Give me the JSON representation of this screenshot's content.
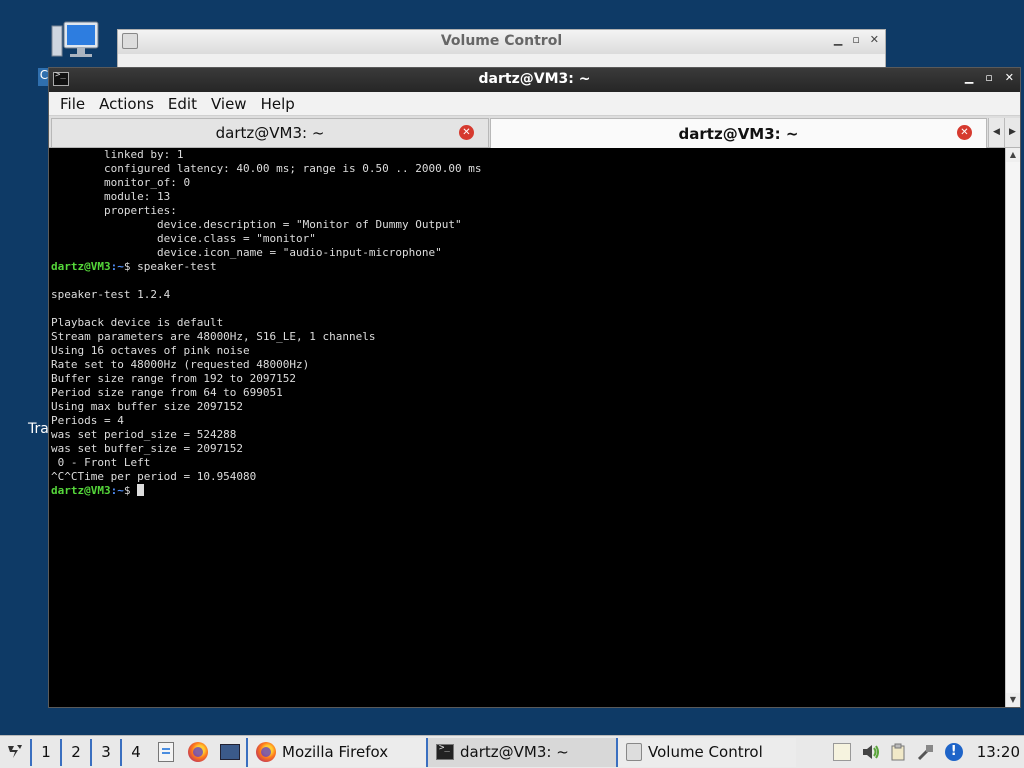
{
  "desktop": {
    "partial_label_left": "Tra",
    "partial_label_c": "C"
  },
  "volume_window": {
    "title": "Volume Control"
  },
  "terminal_window": {
    "title": "dartz@VM3: ~",
    "menu": [
      "File",
      "Actions",
      "Edit",
      "View",
      "Help"
    ],
    "tabs": [
      {
        "label": "dartz@VM3: ~",
        "active": false
      },
      {
        "label": "dartz@VM3: ~",
        "active": true
      }
    ],
    "lines": [
      {
        "text": "        linked by: 1"
      },
      {
        "text": "        configured latency: 40.00 ms; range is 0.50 .. 2000.00 ms"
      },
      {
        "text": "        monitor_of: 0"
      },
      {
        "text": "        module: 13"
      },
      {
        "text": "        properties:"
      },
      {
        "text": "                device.description = \"Monitor of Dummy Output\""
      },
      {
        "text": "                device.class = \"monitor\""
      },
      {
        "text": "                device.icon_name = \"audio-input-microphone\""
      },
      {
        "prompt": true,
        "user": "dartz@VM3",
        "path": ":~",
        "cmd": "$ speaker-test"
      },
      {
        "text": ""
      },
      {
        "text": "speaker-test 1.2.4"
      },
      {
        "text": ""
      },
      {
        "text": "Playback device is default"
      },
      {
        "text": "Stream parameters are 48000Hz, S16_LE, 1 channels"
      },
      {
        "text": "Using 16 octaves of pink noise"
      },
      {
        "text": "Rate set to 48000Hz (requested 48000Hz)"
      },
      {
        "text": "Buffer size range from 192 to 2097152"
      },
      {
        "text": "Period size range from 64 to 699051"
      },
      {
        "text": "Using max buffer size 2097152"
      },
      {
        "text": "Periods = 4"
      },
      {
        "text": "was set period_size = 524288"
      },
      {
        "text": "was set buffer_size = 2097152"
      },
      {
        "text": " 0 - Front Left"
      },
      {
        "text": "^C^CTime per period = 10.954080"
      },
      {
        "prompt": true,
        "user": "dartz@VM3",
        "path": ":~",
        "cmd": "$ ",
        "cursor": true
      }
    ]
  },
  "taskbar": {
    "workspaces": [
      "1",
      "2",
      "3",
      "4"
    ],
    "tasks": [
      {
        "label": "Mozilla Firefox",
        "icon": "firefox-icon"
      },
      {
        "label": "dartz@VM3: ~",
        "icon": "terminal-icon",
        "active": true
      },
      {
        "label": "Volume Control",
        "icon": "volume-control-icon"
      }
    ],
    "clock": "13:20"
  },
  "colors": {
    "desktop_bg": "#0e3a66",
    "prompt_user": "#55d73a",
    "prompt_path": "#4f8df7",
    "close_red": "#d63a2f",
    "workspace_accent": "#3a6fc0"
  }
}
